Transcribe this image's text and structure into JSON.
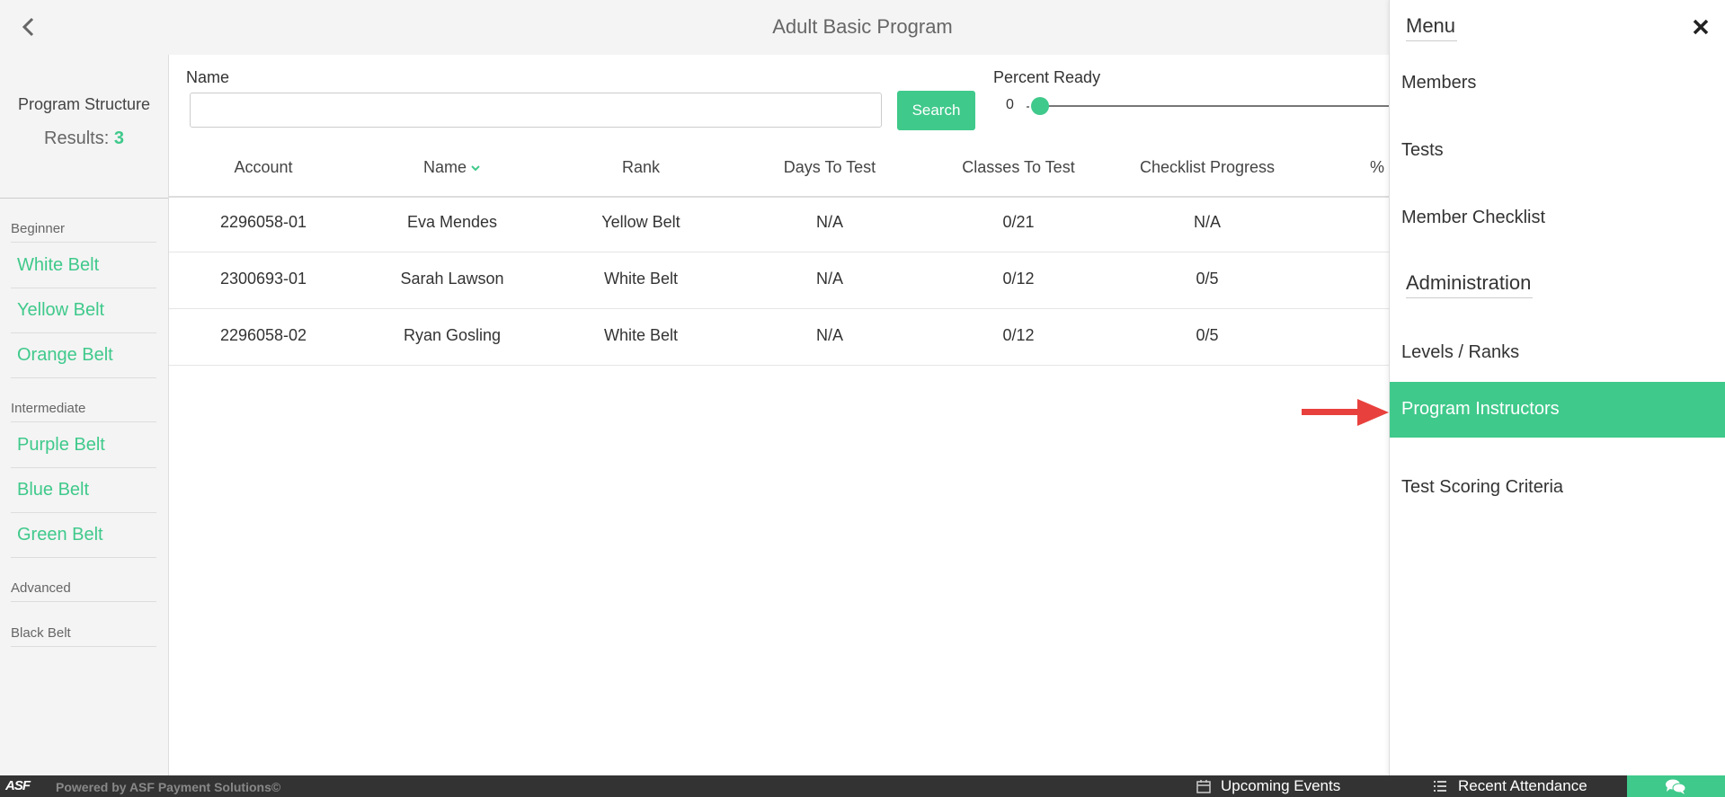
{
  "header": {
    "title": "Adult Basic Program",
    "back_icon": "chevron-left-icon"
  },
  "sidebar": {
    "title": "Program Structure",
    "results_label": "Results:",
    "results_count": "3",
    "groups": [
      {
        "label": "Beginner",
        "items": [
          "White Belt",
          "Yellow Belt",
          "Orange Belt"
        ]
      },
      {
        "label": "Intermediate",
        "items": [
          "Purple Belt",
          "Blue Belt",
          "Green Belt"
        ]
      },
      {
        "label": "Advanced",
        "items": []
      },
      {
        "label": "Black Belt",
        "items": []
      }
    ]
  },
  "filters": {
    "name_label": "Name",
    "name_value": "",
    "search_label": "Search",
    "percent_label": "Percent Ready",
    "percent_min": "0",
    "percent_value": 0
  },
  "table": {
    "columns": [
      "Account",
      "Name",
      "Rank",
      "Days To Test",
      "Classes To Test",
      "Checklist Progress",
      "%"
    ],
    "sorted_column": "Name",
    "rows": [
      [
        "2296058-01",
        "Eva Mendes",
        "Yellow Belt",
        "N/A",
        "0/21",
        "N/A"
      ],
      [
        "2300693-01",
        "Sarah Lawson",
        "White Belt",
        "N/A",
        "0/12",
        "0/5"
      ],
      [
        "2296058-02",
        "Ryan Gosling",
        "White Belt",
        "N/A",
        "0/12",
        "0/5"
      ]
    ]
  },
  "menu": {
    "title": "Menu",
    "close_icon": "close-icon",
    "items": [
      "Members",
      "Tests",
      "Member Checklist"
    ],
    "admin_title": "Administration",
    "admin_items": [
      "Levels / Ranks",
      "Program Instructors",
      "Test Scoring Criteria"
    ],
    "active_item": "Program Instructors"
  },
  "annotation": {
    "arrow_icon": "red-arrow-icon",
    "arrow_color": "#e8413d"
  },
  "footer": {
    "logo": "ASF",
    "powered_by": "Powered by ASF Payment Solutions©",
    "upcoming_events": "Upcoming Events",
    "recent_attendance": "Recent Attendance",
    "chat_icon": "chat-icon"
  },
  "colors": {
    "accent": "#3fc98b",
    "topbar": "#f4f4f4",
    "footer": "#333333"
  }
}
